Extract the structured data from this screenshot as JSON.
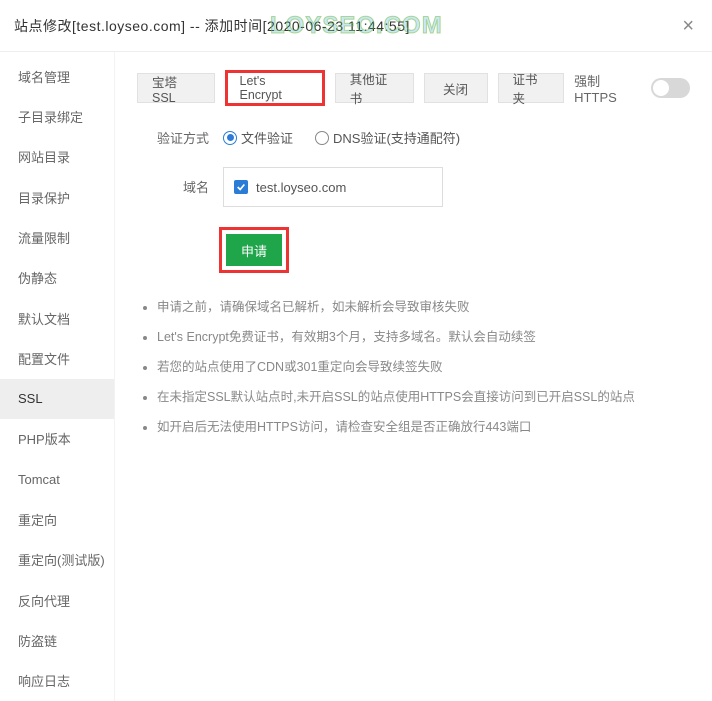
{
  "header": {
    "title": "站点修改[test.loyseo.com] -- 添加时间[2020-06-23 11:44:55]",
    "watermark": "LOYSEO.COM"
  },
  "sidebar": {
    "items": [
      {
        "label": "域名管理",
        "active": false
      },
      {
        "label": "子目录绑定",
        "active": false
      },
      {
        "label": "网站目录",
        "active": false
      },
      {
        "label": "目录保护",
        "active": false
      },
      {
        "label": "流量限制",
        "active": false
      },
      {
        "label": "伪静态",
        "active": false
      },
      {
        "label": "默认文档",
        "active": false
      },
      {
        "label": "配置文件",
        "active": false
      },
      {
        "label": "SSL",
        "active": true
      },
      {
        "label": "PHP版本",
        "active": false
      },
      {
        "label": "Tomcat",
        "active": false
      },
      {
        "label": "重定向",
        "active": false
      },
      {
        "label": "重定向(测试版)",
        "active": false
      },
      {
        "label": "反向代理",
        "active": false
      },
      {
        "label": "防盗链",
        "active": false
      },
      {
        "label": "响应日志",
        "active": false
      }
    ]
  },
  "tabs": {
    "items": [
      {
        "label": "宝塔SSL",
        "active": false
      },
      {
        "label": "Let's Encrypt",
        "active": true
      },
      {
        "label": "其他证书",
        "active": false
      },
      {
        "label": "关闭",
        "active": false
      },
      {
        "label": "证书夹",
        "active": false
      }
    ],
    "force_https_label": "强制HTTPS"
  },
  "form": {
    "verify_label": "验证方式",
    "verify_options": {
      "file": "文件验证",
      "dns": "DNS验证(支持通配符)"
    },
    "domain_label": "域名",
    "domain_value": "test.loyseo.com",
    "apply_label": "申请"
  },
  "notes": [
    "申请之前，请确保域名已解析，如未解析会导致审核失败",
    "Let's Encrypt免费证书，有效期3个月，支持多域名。默认会自动续签",
    "若您的站点使用了CDN或301重定向会导致续签失败",
    "在未指定SSL默认站点时,未开启SSL的站点使用HTTPS会直接访问到已开启SSL的站点",
    "如开启后无法使用HTTPS访问，请检查安全组是否正确放行443端口"
  ]
}
